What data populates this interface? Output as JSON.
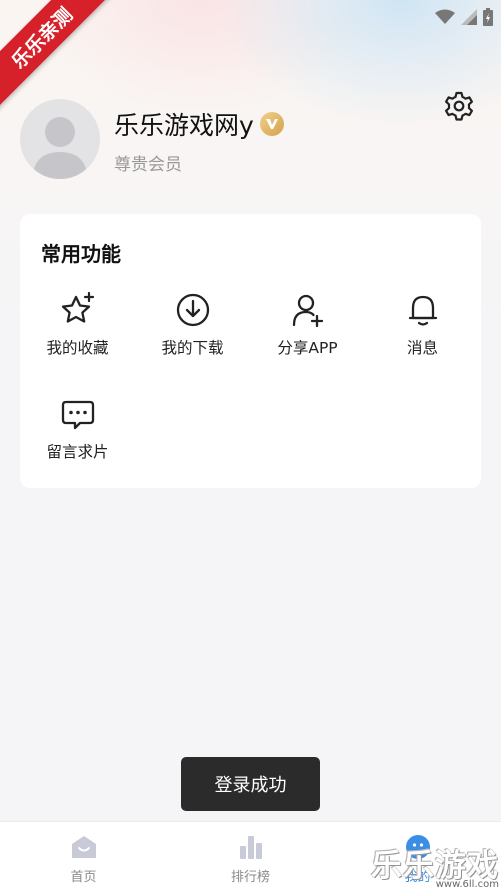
{
  "ribbon": {
    "label": "乐乐亲测"
  },
  "profile": {
    "username": "乐乐游戏网y",
    "member_level": "尊贵会员",
    "badge_icon": "vip-v-icon"
  },
  "functions": {
    "title": "常用功能",
    "items": [
      {
        "label": "我的收藏",
        "icon": "star-icon"
      },
      {
        "label": "我的下载",
        "icon": "download-icon"
      },
      {
        "label": "分享APP",
        "icon": "add-user-icon"
      },
      {
        "label": "消息",
        "icon": "bell-icon"
      },
      {
        "label": "留言求片",
        "icon": "message-icon"
      }
    ]
  },
  "toast": {
    "text": "登录成功"
  },
  "tabbar": {
    "items": [
      {
        "label": "首页",
        "icon": "home-icon"
      },
      {
        "label": "排行榜",
        "icon": "bar-chart-icon"
      },
      {
        "label": "我的",
        "icon": "profile-icon"
      }
    ],
    "active_index": 2
  },
  "watermark": {
    "title": "乐乐游戏",
    "url": "www.6ll.com"
  },
  "colors": {
    "accent": "#3a8ee6",
    "ribbon": "#d6202a",
    "vip": "#d4a24d"
  }
}
